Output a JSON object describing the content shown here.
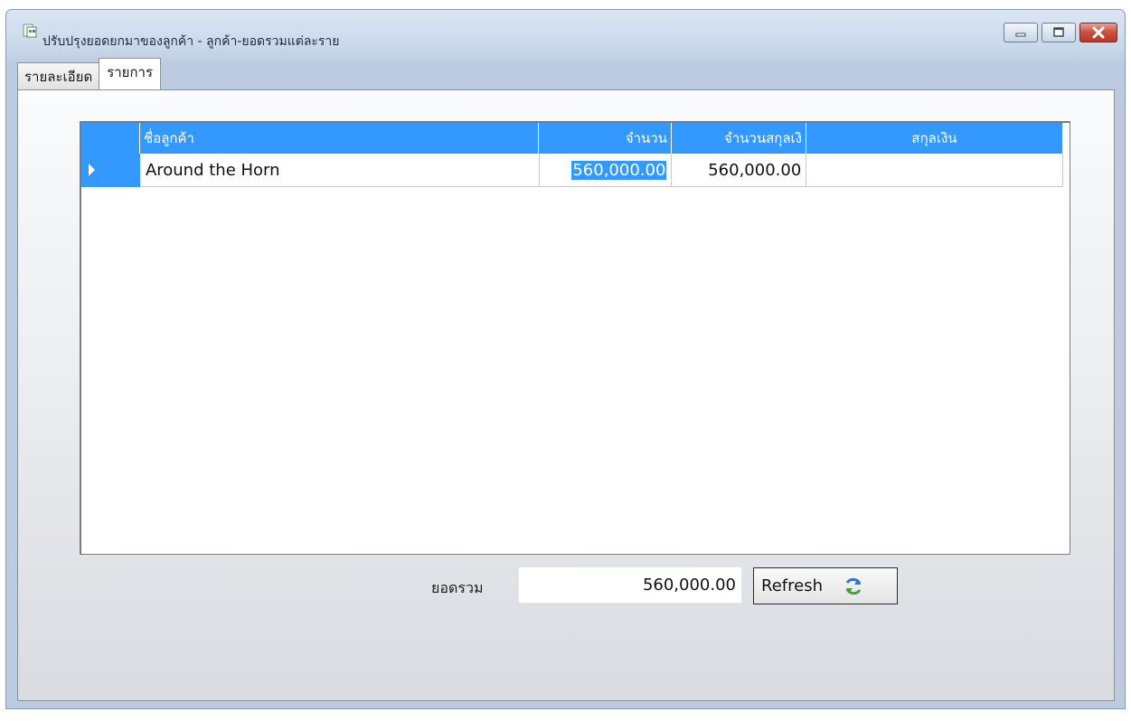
{
  "window": {
    "title": "ปรับปรุงยอดยกมาของลูกค้า - ลูกค้า-ยอดรวมแต่ละราย",
    "icon": "app-document-icon"
  },
  "caption_buttons": {
    "minimize_icon": "minimize-icon",
    "maximize_icon": "maximize-icon",
    "close_icon": "close-icon"
  },
  "tabs": [
    {
      "label": "รายละเอียด",
      "active": false
    },
    {
      "label": "รายการ",
      "active": true
    }
  ],
  "grid": {
    "columns": [
      {
        "label": ""
      },
      {
        "label": "ชื่อลูกค้า"
      },
      {
        "label": "จำนวน"
      },
      {
        "label": "จำนวนสกุลเงิ"
      },
      {
        "label": "สกุลเงิน"
      }
    ],
    "rows": [
      {
        "customer": "Around the Horn",
        "amount": "560,000.00",
        "amount_currency": "560,000.00",
        "currency": ""
      }
    ]
  },
  "footer": {
    "total_label": "ยอดรวม",
    "total_value": "560,000.00",
    "refresh_label": "Refresh",
    "refresh_icon": "refresh-icon"
  },
  "colors": {
    "selection": "#3399ff",
    "close_button": "#c74f3b"
  }
}
